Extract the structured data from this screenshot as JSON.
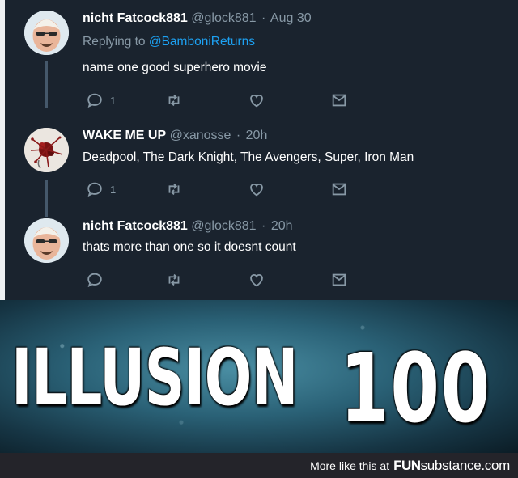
{
  "tweets": [
    {
      "display_name": "nicht Fatcock881",
      "handle": "@glock881",
      "sep": "·",
      "time": "Aug 30",
      "replying_prefix": "Replying to",
      "replying_handle": "@BamboniReturns",
      "text": "name one good superhero movie",
      "avatar_icon": "bald-man-avatar-icon",
      "reply_count": "1"
    },
    {
      "display_name": "WAKE ME UP",
      "handle": "@xanosse",
      "sep": "·",
      "time": "20h",
      "text": "Deadpool, The Dark Knight, The Avengers, Super, Iron Man",
      "avatar_icon": "splatter-avatar-icon",
      "reply_count": "1"
    },
    {
      "display_name": "nicht Fatcock881",
      "handle": "@glock881",
      "sep": "·",
      "time": "20h",
      "text": "thats more than one so it doesnt count",
      "avatar_icon": "bald-man-avatar-icon",
      "reply_count": ""
    }
  ],
  "icons": [
    "reply-icon",
    "retweet-icon",
    "like-icon",
    "dm-icon"
  ],
  "banner": {
    "word": "ILLUSION",
    "number": "100"
  },
  "footer": {
    "more": "More like this at",
    "brand_bold": "FUN",
    "brand_rest": "substance.com"
  },
  "colors": {
    "background": "#1a232e",
    "text": "#ffffff",
    "muted": "#8899a6",
    "link": "#1da1f2"
  }
}
